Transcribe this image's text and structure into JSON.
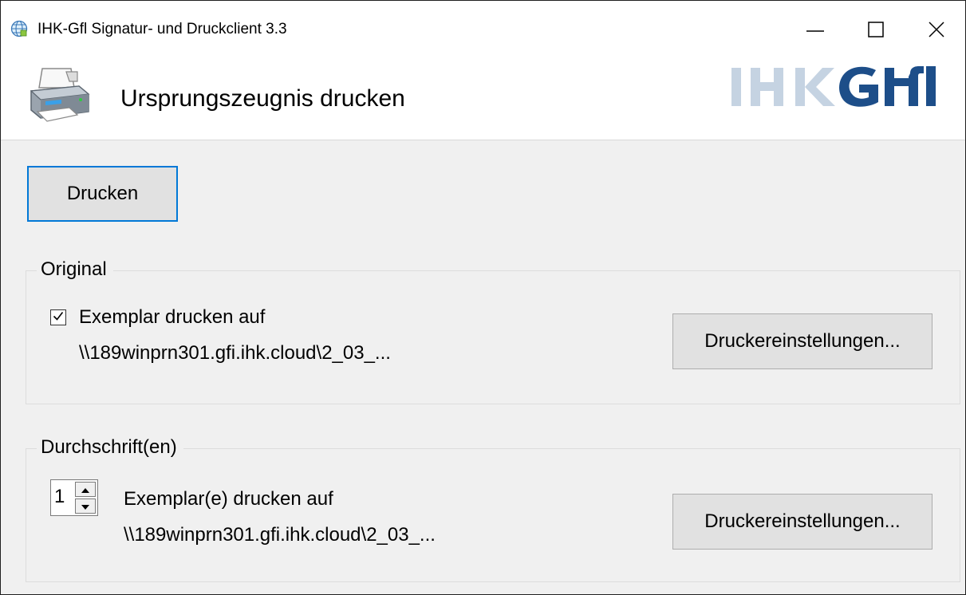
{
  "window": {
    "title": "IHK-Gfl Signatur- und Druckclient 3.3",
    "icon": "globe-icon",
    "controls": [
      "minimize-icon",
      "maximize-icon",
      "close-icon"
    ]
  },
  "header": {
    "icon": "printer-icon",
    "title": "Ursprungszeugnis drucken",
    "logo_text": "IHKGfl",
    "logo_colors": {
      "light": "#c5d3e2",
      "dark": "#1d4e89"
    }
  },
  "actions": {
    "print_label": "Drucken"
  },
  "original": {
    "group_label": "Original",
    "checkbox_checked": true,
    "checkbox_label": "Exemplar drucken auf",
    "printer_path": "\\\\189winprn301.gfi.ihk.cloud\\2_03_...",
    "settings_label": "Druckereinstellungen..."
  },
  "copies": {
    "group_label": "Durchschrift(en)",
    "count": "1",
    "label": "Exemplar(e) drucken auf",
    "printer_path": "\\\\189winprn301.gfi.ihk.cloud\\2_03_...",
    "settings_label": "Druckereinstellungen..."
  },
  "colors": {
    "accent": "#0078d7",
    "window_bg": "#f0f0f0",
    "button_bg": "#e1e1e1"
  }
}
